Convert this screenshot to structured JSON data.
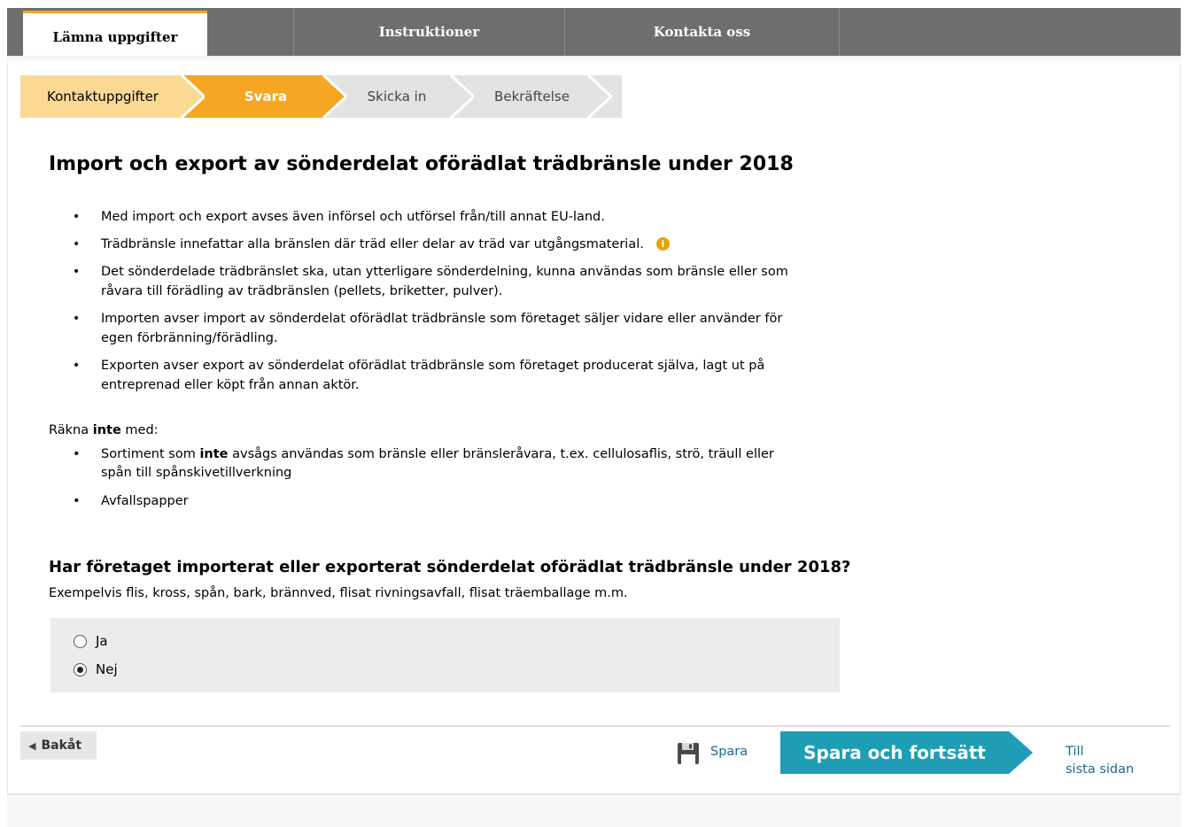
{
  "nav": {
    "tabs": [
      {
        "label": "Lämna uppgifter",
        "active": true
      },
      {
        "label": "Instruktioner",
        "active": false
      },
      {
        "label": "Kontakta oss",
        "active": false
      }
    ]
  },
  "steps": [
    {
      "label": "Kontaktuppgifter",
      "state": "done"
    },
    {
      "label": "Svara",
      "state": "current"
    },
    {
      "label": "Skicka in",
      "state": "upcoming"
    },
    {
      "label": "Bekräftelse",
      "state": "upcoming"
    }
  ],
  "page": {
    "title": "Import och export av sönderdelat oförädlat trädbränsle under 2018",
    "bullets": [
      "Med import och export avses även införsel och utförsel från/till annat EU-land.",
      "Trädbränsle innefattar alla bränslen där träd eller delar av träd var utgångsmaterial.",
      "Det sönderdelade trädbränslet ska, utan ytterligare sönderdelning, kunna användas som bränsle eller som råvara till förädling av trädbränslen (pellets, briketter, pulver).",
      "Importen avser import av sönderdelat oförädlat trädbränsle som företaget säljer vidare eller använder för egen förbränning/förädling.",
      "Exporten avser export av sönderdelat oförädlat trädbränsle som företaget producerat själva, lagt ut på entreprenad eller köpt från annan aktör."
    ],
    "exclude_intro_pre": "Räkna ",
    "exclude_intro_bold": "inte",
    "exclude_intro_post": " med:",
    "exclude_1_pre": "Sortiment som ",
    "exclude_1_bold": "inte",
    "exclude_1_post": " avsågs användas som bränsle eller bränsleråvara, t.ex. cellulosaflis, strö, träull eller spån till spånskivetillverkning",
    "exclude_2": "Avfallspapper",
    "question": "Har företaget importerat eller exporterat sönderdelat oförädlat trädbränsle under 2018?",
    "question_sub": "Exempelvis flis, kross, spån, bark, brännved, flisat rivningsavfall, flisat träemballage m.m.",
    "options": [
      {
        "label": "Ja",
        "selected": false
      },
      {
        "label": "Nej",
        "selected": true
      }
    ]
  },
  "footer": {
    "back_label": "Bakåt",
    "save_label": "Spara",
    "primary_label": "Spara och fortsätt",
    "last_line1": "Till",
    "last_line2": "sista sidan"
  },
  "colors": {
    "accent_orange": "#f5a623",
    "done_step": "#fbd894",
    "primary_teal": "#1f9db5",
    "nav_gray": "#6e6e6e"
  }
}
